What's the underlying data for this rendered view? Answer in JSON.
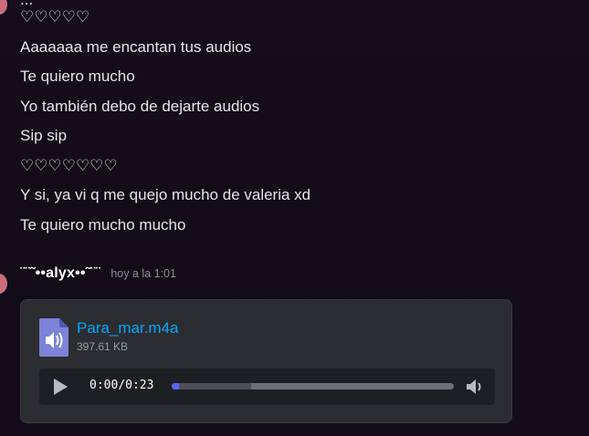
{
  "previous_message": {
    "header_fragment": "...",
    "lines": [
      "♡♡♡♡♡",
      "Aaaaaaa me encantan tus audios",
      "Te quiero mucho",
      "Yo también debo de dejarte audios",
      "Sip sip",
      "♡♡♡♡♡♡♡",
      "Y si, ya vi q me quejo mucho de valeria xd",
      "Te quiero mucho mucho"
    ]
  },
  "message": {
    "author": "¨¨˜••alyx••˜¨¨",
    "timestamp": "hoy a la 1:01",
    "attachment": {
      "file_name": "Para_mar.m4a",
      "file_size": "397.61 KB",
      "file_icon": "audio-file-icon",
      "player": {
        "current_time": "0:00",
        "separator": "/",
        "duration": "0:23",
        "progress": 0.0,
        "buffered": 0.28,
        "play_icon": "play-icon",
        "volume_icon": "volume-icon"
      }
    }
  },
  "colors": {
    "link": "#00a8fc",
    "accent": "#5865f2",
    "avatar": "#c96e7a"
  }
}
